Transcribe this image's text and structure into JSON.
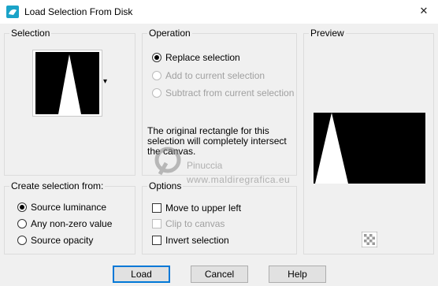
{
  "window": {
    "title": "Load Selection From Disk",
    "close_glyph": "✕"
  },
  "selection": {
    "label": "Selection",
    "dropdown_glyph": "▾"
  },
  "operation": {
    "label": "Operation",
    "options": [
      {
        "label": "Replace selection",
        "selected": true,
        "enabled": true
      },
      {
        "label": "Add to current selection",
        "selected": false,
        "enabled": false
      },
      {
        "label": "Subtract from current selection",
        "selected": false,
        "enabled": false
      }
    ],
    "message": "The original rectangle for this selection will completely intersect the canvas."
  },
  "preview": {
    "label": "Preview"
  },
  "create_from": {
    "label": "Create selection from:",
    "options": [
      {
        "label": "Source luminance",
        "selected": true
      },
      {
        "label": "Any non-zero value",
        "selected": false
      },
      {
        "label": "Source opacity",
        "selected": false
      }
    ]
  },
  "options": {
    "label": "Options",
    "items": [
      {
        "label": "Move to upper left",
        "checked": false,
        "enabled": true
      },
      {
        "label": "Clip to canvas",
        "checked": false,
        "enabled": false
      },
      {
        "label": "Invert selection",
        "checked": false,
        "enabled": true
      }
    ]
  },
  "watermark": {
    "name": "Pinuccia",
    "site": "www.maldiregrafica.eu"
  },
  "buttons": {
    "load": "Load",
    "cancel": "Cancel",
    "help": "Help"
  }
}
